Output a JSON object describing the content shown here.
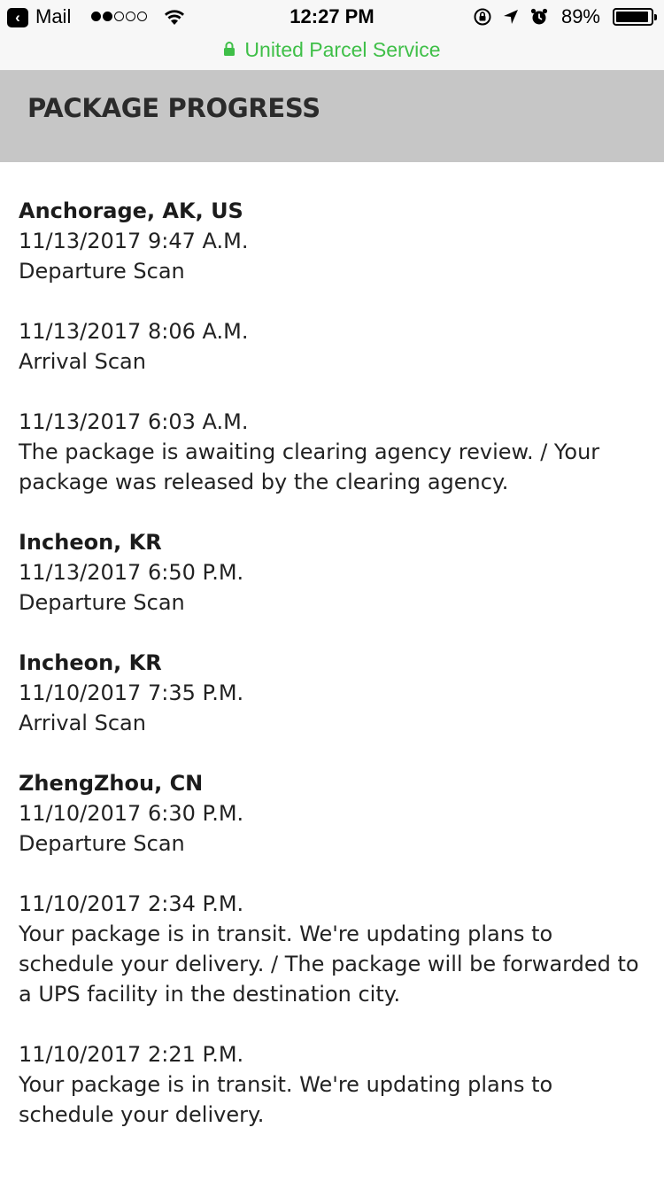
{
  "status_bar": {
    "back_app": "Mail",
    "signal_bars_on": 2,
    "signal_bars_total": 5,
    "time": "12:27 PM",
    "battery_percent": "89%",
    "icons": [
      "back-arrow-icon",
      "wifi-icon",
      "orientation-lock-icon",
      "location-arrow-icon",
      "alarm-icon",
      "battery-icon",
      "lock-icon"
    ]
  },
  "url_bar": {
    "site_name": "United Parcel Service",
    "color": "#3fbf48"
  },
  "header": {
    "title": "PACKAGE PROGRESS",
    "background": "#c6c6c6"
  },
  "events": [
    {
      "location": "Anchorage, AK, US",
      "datetime": "11/13/2017 9:47 A.M.",
      "description": "Departure Scan"
    },
    {
      "location": "",
      "datetime": "11/13/2017 8:06 A.M.",
      "description": "Arrival Scan"
    },
    {
      "location": "",
      "datetime": "11/13/2017 6:03 A.M.",
      "description": "The package is awaiting clearing agency review. / Your package was released by the clearing agency."
    },
    {
      "location": "Incheon, KR",
      "datetime": "11/13/2017 6:50 P.M.",
      "description": "Departure Scan"
    },
    {
      "location": "Incheon, KR",
      "datetime": "11/10/2017 7:35 P.M.",
      "description": "Arrival Scan"
    },
    {
      "location": "ZhengZhou, CN",
      "datetime": "11/10/2017 6:30 P.M.",
      "description": "Departure Scan"
    },
    {
      "location": "",
      "datetime": "11/10/2017 2:34 P.M.",
      "description": "Your package is in transit. We're updating plans to schedule your delivery. / The package will be forwarded to a UPS facility in the destination city."
    },
    {
      "location": "",
      "datetime": "11/10/2017 2:21 P.M.",
      "description": "Your package is in transit. We're updating plans to schedule your delivery."
    }
  ]
}
